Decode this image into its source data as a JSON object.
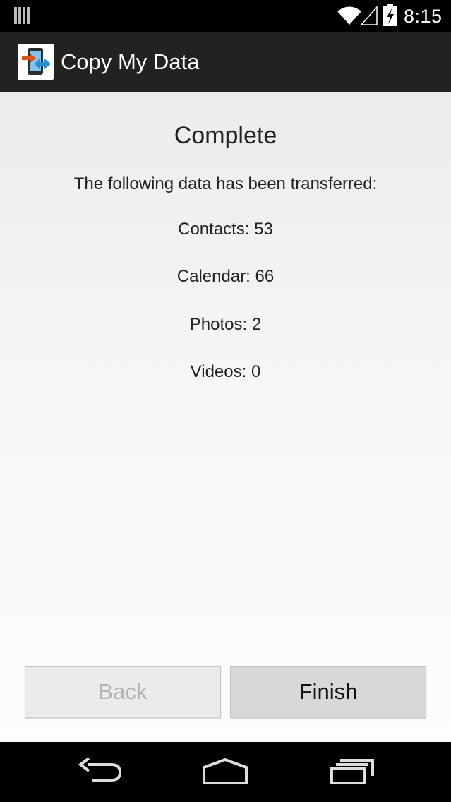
{
  "status_bar": {
    "time": "8:15",
    "icons": [
      "notification-icon",
      "wifi-icon",
      "signal-icon",
      "battery-charging-icon"
    ]
  },
  "action_bar": {
    "title": "Copy My Data",
    "icon": "copy-my-data-app-icon"
  },
  "main": {
    "heading": "Complete",
    "intro": "The following data has been transferred:",
    "stats": [
      {
        "label": "Contacts: 53"
      },
      {
        "label": "Calendar: 66"
      },
      {
        "label": "Photos: 2"
      },
      {
        "label": "Videos: 0"
      }
    ]
  },
  "buttons": {
    "back_label": "Back",
    "back_enabled": false,
    "finish_label": "Finish"
  },
  "nav_bar": {
    "icons": [
      "back-nav-icon",
      "home-nav-icon",
      "recents-nav-icon"
    ]
  },
  "colors": {
    "action_bar": "#222222",
    "disabled_text": "#b3b3b3",
    "icon_orange": "#d9541e",
    "icon_blue": "#2b8fd6"
  }
}
